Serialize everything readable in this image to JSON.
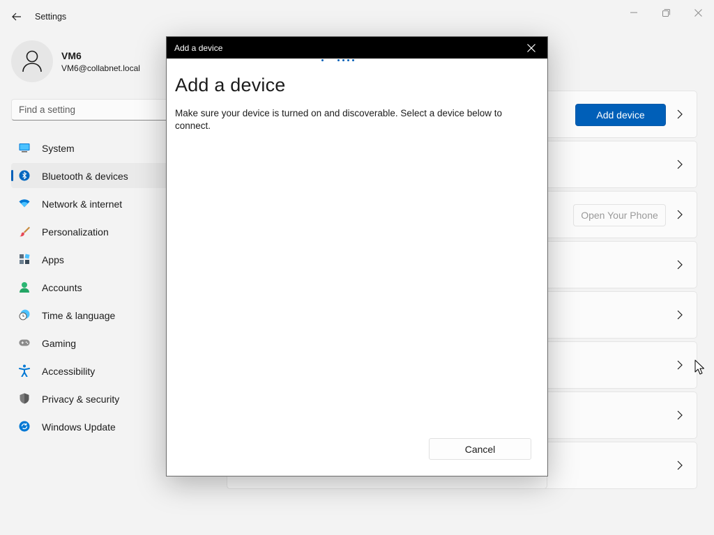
{
  "window": {
    "title": "Settings",
    "back_icon": "back-arrow-icon",
    "controls": [
      "minimize-icon",
      "maximize-icon",
      "close-icon"
    ]
  },
  "profile": {
    "name": "VM6",
    "email": "VM6@collabnet.local"
  },
  "search": {
    "placeholder": "Find a setting"
  },
  "sidebar": {
    "active_index": 1,
    "items": [
      {
        "label": "System",
        "icon": "monitor-icon"
      },
      {
        "label": "Bluetooth & devices",
        "icon": "bluetooth-icon"
      },
      {
        "label": "Network & internet",
        "icon": "wifi-icon"
      },
      {
        "label": "Personalization",
        "icon": "brush-icon"
      },
      {
        "label": "Apps",
        "icon": "apps-icon"
      },
      {
        "label": "Accounts",
        "icon": "person-icon"
      },
      {
        "label": "Time & language",
        "icon": "clock-globe-icon"
      },
      {
        "label": "Gaming",
        "icon": "gamepad-icon"
      },
      {
        "label": "Accessibility",
        "icon": "accessibility-icon"
      },
      {
        "label": "Privacy & security",
        "icon": "shield-icon"
      },
      {
        "label": "Windows Update",
        "icon": "update-icon"
      }
    ]
  },
  "main": {
    "add_device_label": "Add device",
    "open_phone_label": "Open Your Phone"
  },
  "dialog": {
    "window_title": "Add a device",
    "heading": "Add a device",
    "description": "Make sure your device is turned on and discoverable. Select a device below to connect.",
    "cancel_label": "Cancel"
  },
  "colors": {
    "accent": "#005fb8",
    "dialog_titlebar": "#000000",
    "background": "#f3f3f3"
  }
}
